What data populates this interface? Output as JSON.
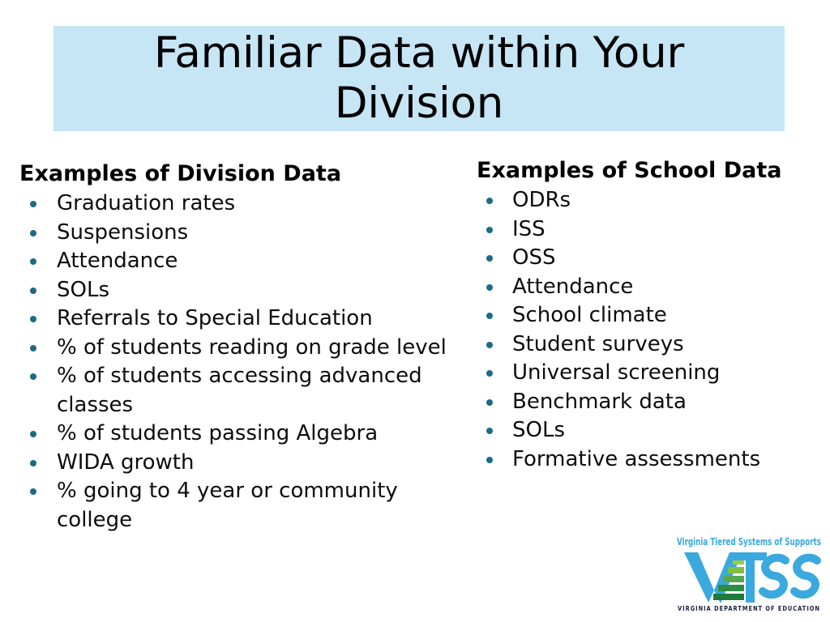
{
  "slide": {
    "title": "Familiar Data within Your Division",
    "banner_color": "#c6e5f5",
    "bullet_color": "#1b6b85",
    "text_color": "#0d0d0d"
  },
  "left_column": {
    "heading": "Examples of Division Data",
    "items": [
      "Graduation rates",
      "Suspensions",
      "Attendance",
      "SOLs",
      "Referrals to Special Education",
      "% of students reading on grade level",
      "% of students accessing advanced classes",
      "% of students passing Algebra",
      "WIDA growth",
      "% going to 4 year or community college"
    ]
  },
  "right_column": {
    "heading": "Examples of School Data",
    "items": [
      "ODRs",
      "ISS",
      "OSS",
      "Attendance",
      "School climate",
      "Student surveys",
      "Universal screening",
      "Benchmark data",
      "SOLs",
      "Formative assessments"
    ]
  },
  "logo": {
    "tagline": "Virginia Tiered Systems of Supports",
    "wordmark": "VTSS",
    "footer": "VIRGINIA DEPARTMENT OF EDUCATION",
    "blue": "#3aa9dd",
    "tagline_blue": "#3aa9dd",
    "green_dark": "#1f7a3d",
    "green_mid": "#4da64f",
    "green_light": "#8cc63f",
    "footer_color": "#1a1f3c"
  }
}
